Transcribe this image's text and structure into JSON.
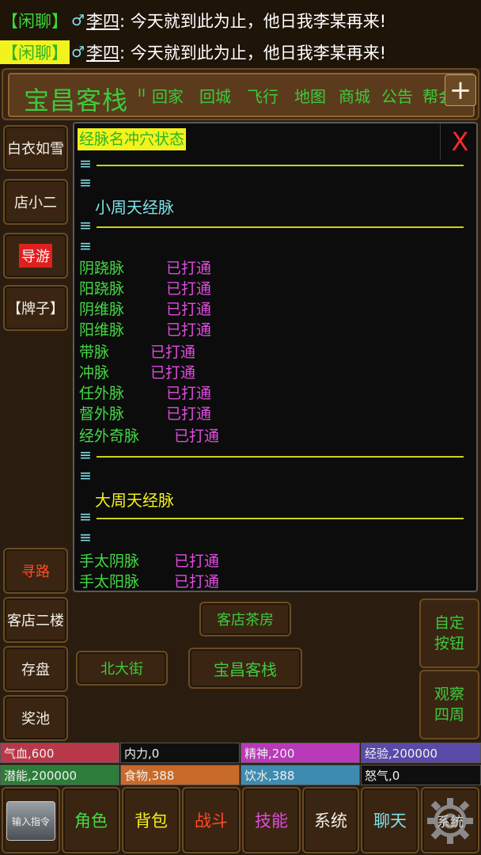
{
  "chat": {
    "lines": [
      {
        "tag": "【闲聊】",
        "gender": "♂",
        "speaker": "李四",
        "message": ": 今天就到此为止，他日我李某再来!"
      },
      {
        "tag": "【闲聊】",
        "gender": "♂",
        "speaker": "李四",
        "message": ": 今天就到此为止，他日我李某再来!"
      }
    ]
  },
  "toolbar": {
    "place": "宝昌客栈",
    "buttons": [
      "回家",
      "回城",
      "飞行",
      "地图",
      "商城",
      "公告",
      "帮会"
    ],
    "plus": "+"
  },
  "left_column": {
    "top": [
      "白衣如雪",
      "店小二",
      "导游",
      "【牌子】"
    ],
    "bottom": [
      "寻路",
      "客店二楼",
      "存盘",
      "奖池"
    ]
  },
  "panel": {
    "title": "经脉名冲穴状态",
    "close": "X",
    "eq": "≡",
    "section_small": "小周天经脉",
    "section_big": "大周天经脉",
    "small_meridians": [
      {
        "name": "阴跷脉",
        "state": "已打通"
      },
      {
        "name": "阳跷脉",
        "state": "已打通"
      },
      {
        "name": "阴维脉",
        "state": "已打通"
      },
      {
        "name": "阳维脉",
        "state": "已打通"
      },
      {
        "name": "带脉",
        "state": "已打通"
      },
      {
        "name": "冲脉",
        "state": "已打通"
      },
      {
        "name": "任外脉",
        "state": "已打通"
      },
      {
        "name": "督外脉",
        "state": "已打通"
      },
      {
        "name": "经外奇脉",
        "state": "已打通"
      }
    ],
    "big_meridians": [
      {
        "name": "手太阴脉",
        "state": "已打通"
      },
      {
        "name": "手太阳脉",
        "state": "已打通"
      }
    ]
  },
  "scene": {
    "exits": [
      "客店茶房",
      "北大街",
      "宝昌客栈"
    ],
    "right_buttons": [
      "自定按钮",
      "观察四周"
    ]
  },
  "stats": [
    {
      "label": "气血",
      "value": "600",
      "color": "#b8384a"
    },
    {
      "label": "内力",
      "value": "0",
      "color": "#0f0f0f"
    },
    {
      "label": "精神",
      "value": "200",
      "color": "#b83ab8"
    },
    {
      "label": "经验",
      "value": "200000",
      "color": "#5a4aa8"
    },
    {
      "label": "潜能",
      "value": "200000",
      "color": "#2d7d3a"
    },
    {
      "label": "食物",
      "value": "388",
      "color": "#c86a2a"
    },
    {
      "label": "饮水",
      "value": "388",
      "color": "#3e8bb0"
    },
    {
      "label": "怒气",
      "value": "0",
      "color": "#0f0f0f"
    }
  ],
  "nav": {
    "input": "输入指令",
    "items": [
      {
        "label": "角色",
        "color": "#44d944"
      },
      {
        "label": "背包",
        "color": "#f2f21c"
      },
      {
        "label": "战斗",
        "color": "#ff4a2a"
      },
      {
        "label": "技能",
        "color": "#e04ce0"
      },
      {
        "label": "系统",
        "color": "#f2efe6"
      },
      {
        "label": "聊天",
        "color": "#7fe0e8"
      }
    ],
    "settings": "系统"
  }
}
